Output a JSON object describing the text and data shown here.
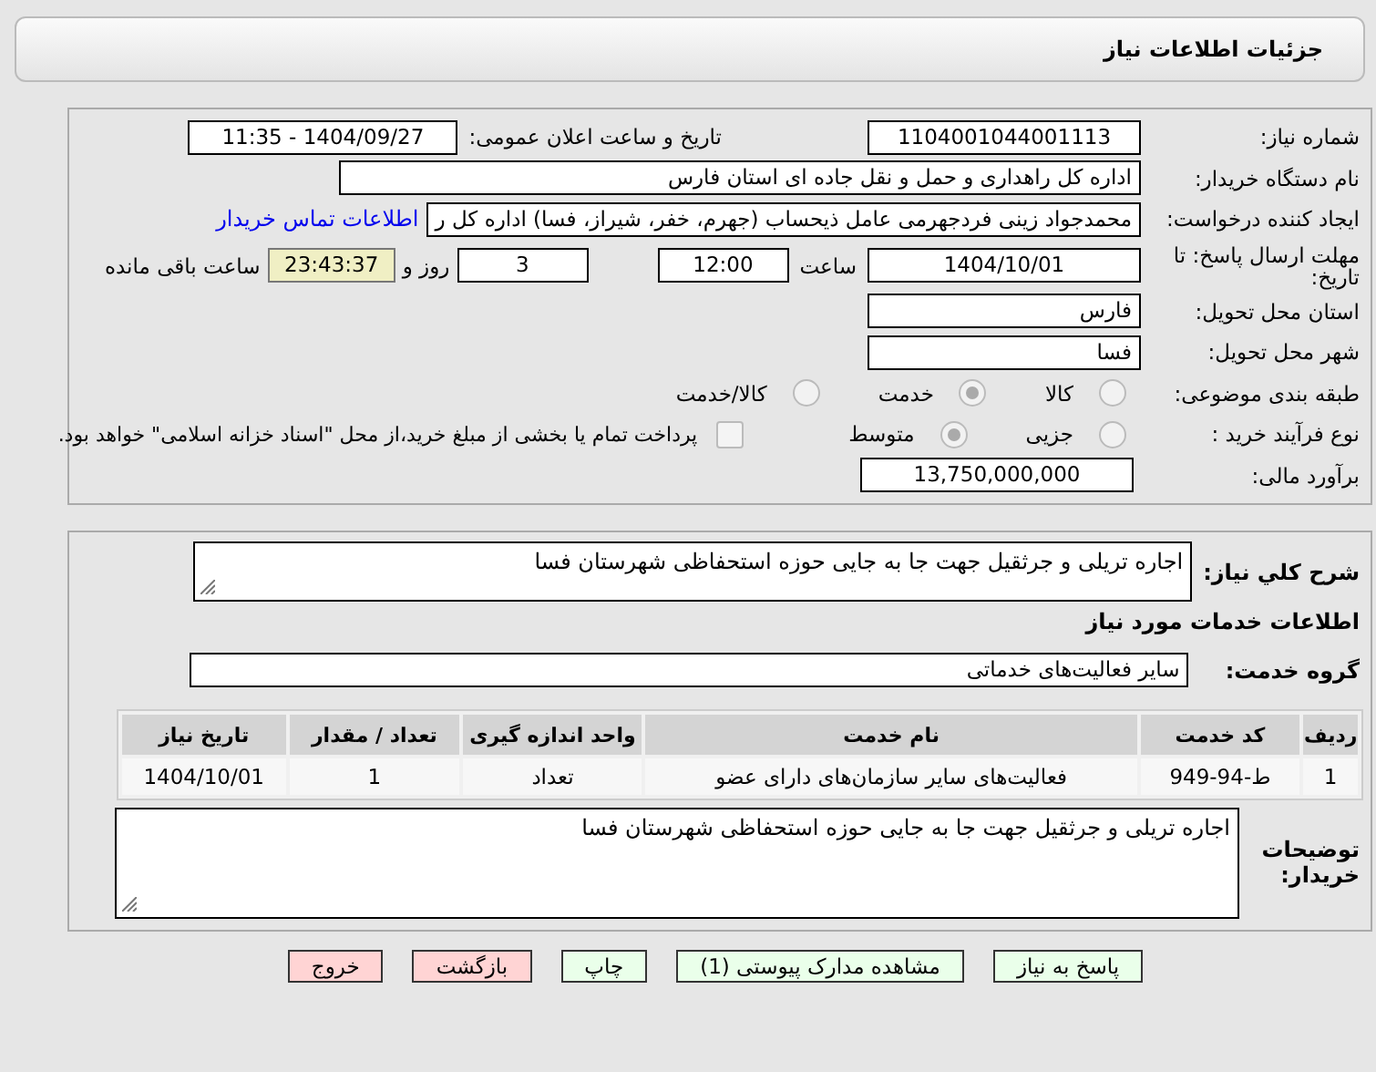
{
  "header": {
    "title": "جزئیات اطلاعات نیاز"
  },
  "details": {
    "need_number": {
      "label": "شماره نیاز:",
      "value": "1104001044001113"
    },
    "announce": {
      "label": "تاریخ و ساعت اعلان عمومی:",
      "value": "1404/09/27 - 11:35"
    },
    "buyer_org": {
      "label": "نام دستگاه خریدار:",
      "value": "اداره کل راهداری و حمل و نقل جاده ای استان فارس"
    },
    "requester": {
      "label": "ایجاد کننده درخواست:",
      "value": "محمدجواد زینی فردجهرمی عامل ذیحساب (جهرم، خفر، شیراز، فسا) اداره کل ر",
      "link": "اطلاعات تماس خریدار"
    },
    "deadline": {
      "label": "مهلت ارسال پاسخ: تا تاریخ:",
      "date": "1404/10/01",
      "time_label": "ساعت",
      "time": "12:00",
      "days": "3",
      "days_label": "روز و",
      "remaining": "23:43:37",
      "remaining_label": "ساعت باقی مانده"
    },
    "province": {
      "label": "استان محل تحویل:",
      "value": "فارس"
    },
    "city": {
      "label": "شهر محل تحویل:",
      "value": "فسا"
    },
    "category": {
      "label": "طبقه بندی موضوعی:",
      "options": [
        {
          "label": "کالا",
          "selected": false
        },
        {
          "label": "خدمت",
          "selected": true
        },
        {
          "label": "کالا/خدمت",
          "selected": false
        }
      ]
    },
    "process": {
      "label": "نوع فرآیند خرید :",
      "options": [
        {
          "label": "جزیی",
          "selected": false
        },
        {
          "label": "متوسط",
          "selected": true
        }
      ],
      "checkbox": {
        "label": "پرداخت تمام یا بخشی از مبلغ خرید،از محل \"اسناد خزانه اسلامی\" خواهد بود.",
        "checked": false
      }
    },
    "budget": {
      "label": "برآورد مالی:",
      "value": "13,750,000,000"
    }
  },
  "description": {
    "label": "شرح کلي نياز:",
    "value": "اجاره تریلی و جرثقیل جهت جا به جایی حوزه استحفاظی شهرستان فسا"
  },
  "services_title": "اطلاعات خدمات مورد نیاز",
  "service_group": {
    "label": "گروه خدمت:",
    "value": "سایر فعالیت‌های خدماتی"
  },
  "table": {
    "columns": [
      "ردیف",
      "کد خدمت",
      "نام خدمت",
      "واحد اندازه گیری",
      "تعداد / مقدار",
      "تاریخ نیاز"
    ],
    "rows": [
      [
        "1",
        "ط-94-949",
        "فعالیت‌های سایر سازمان‌های دارای عضو",
        "تعداد",
        "1",
        "1404/10/01"
      ]
    ]
  },
  "buyer_notes": {
    "label": "توضیحات خریدار:",
    "value": "اجاره تریلی و جرثقیل جهت جا به جایی حوزه استحفاظی شهرستان فسا"
  },
  "buttons": [
    {
      "label": "پاسخ به نیاز",
      "kind": "ok"
    },
    {
      "label": "مشاهده مدارک پیوستی (1)",
      "kind": "ok"
    },
    {
      "label": "چاپ",
      "kind": "ok"
    },
    {
      "label": "بازگشت",
      "kind": "danger"
    },
    {
      "label": "خروج",
      "kind": "danger"
    }
  ]
}
